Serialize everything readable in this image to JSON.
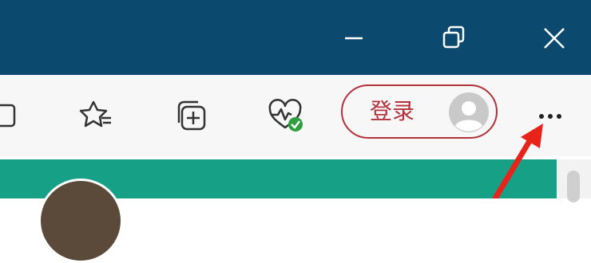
{
  "window": {
    "titlebar_color": "#0b4a6e",
    "controls": [
      {
        "name": "minimize",
        "icon": "minimize-icon"
      },
      {
        "name": "restore",
        "icon": "restore-icon"
      },
      {
        "name": "close",
        "icon": "close-icon"
      }
    ]
  },
  "toolbar": {
    "icons": [
      {
        "name": "tab-actions",
        "icon": "tab-actions-icon"
      },
      {
        "name": "favorites",
        "icon": "favorites-icon"
      },
      {
        "name": "collections",
        "icon": "collections-icon"
      },
      {
        "name": "browser-essentials",
        "icon": "browser-essentials-icon"
      }
    ],
    "signin": {
      "label": "登录",
      "accent_color": "#b2313b",
      "avatar_icon": "avatar-icon"
    },
    "more_icon": "more-icon"
  },
  "page": {
    "banner_color": "#16a085"
  },
  "annotation": {
    "arrow_color": "#e8231a"
  }
}
